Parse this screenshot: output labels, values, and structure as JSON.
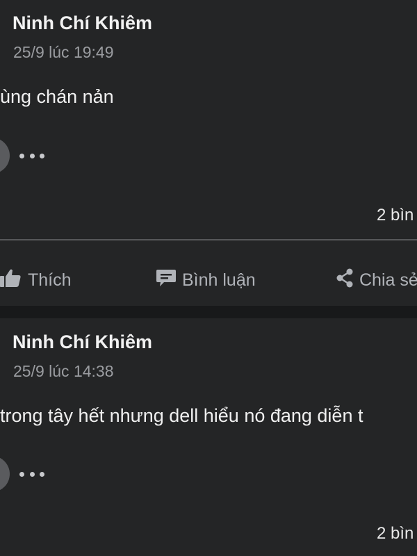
{
  "posts": [
    {
      "author": "Ninh Chí Khiêm",
      "timestamp": "25/9 lúc 19:49",
      "content": "ùng chán nản",
      "comment_count": "2 bìn"
    },
    {
      "author": "Ninh Chí Khiêm",
      "timestamp": "25/9 lúc 14:38",
      "content": "trong tây hết nhưng dell hiểu nó đang diễn t",
      "comment_count": "2 bìn"
    }
  ],
  "actions": {
    "like_label": "Thích",
    "comment_label": "Bình luận",
    "share_label": "Chia sẻ"
  },
  "icons": {
    "like": "thumbs-up-icon",
    "comment": "speech-bubble-icon",
    "share": "share-icon",
    "more": "more-options-icon"
  },
  "colors": {
    "background": "#242526",
    "separator": "#18191a",
    "secondary_text": "#b0b3b8"
  }
}
